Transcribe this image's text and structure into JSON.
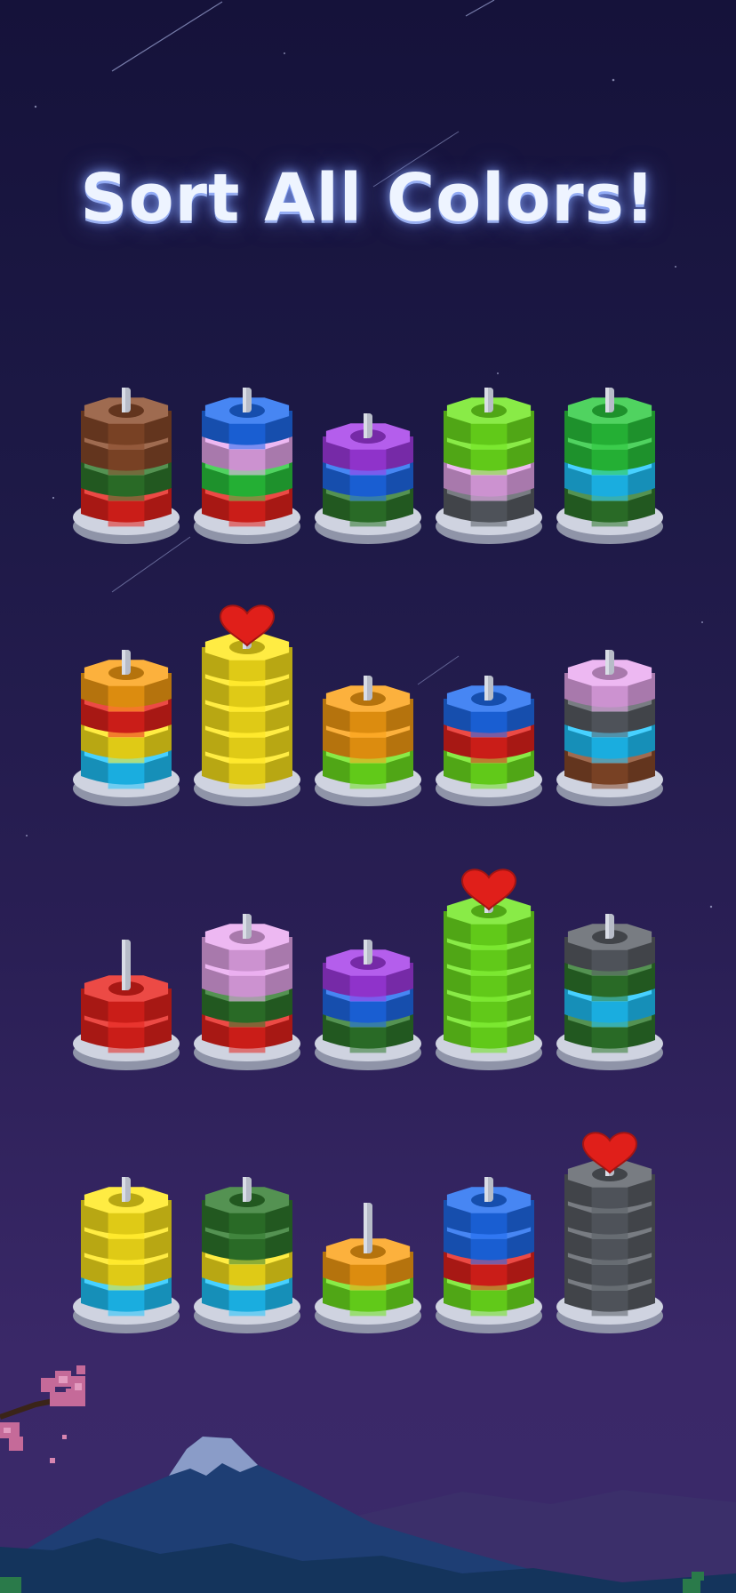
{
  "title": "Sort All Colors!",
  "colors": {
    "red": "#e8221c",
    "brown": "#8a4a2a",
    "dkgreen": "#2f7a2c",
    "green": "#29c93d",
    "lime": "#6fe61e",
    "blue": "#1e6cf0",
    "cyan": "#1fc7ff",
    "pink": "#e9a8ef",
    "purple": "#a43be8",
    "gray": "#5a5f66",
    "yellow": "#ffe81a",
    "orange": "#fba012"
  },
  "tower_rows": [
    {
      "towers": [
        {
          "rings": [
            "red",
            "dkgreen",
            "brown",
            "brown"
          ],
          "heart": false
        },
        {
          "rings": [
            "red",
            "green",
            "pink",
            "blue"
          ],
          "heart": false
        },
        {
          "rings": [
            "dkgreen",
            "blue",
            "purple"
          ],
          "heart": false
        },
        {
          "rings": [
            "gray",
            "pink",
            "lime",
            "lime"
          ],
          "heart": false
        },
        {
          "rings": [
            "dkgreen",
            "cyan",
            "green",
            "green"
          ],
          "heart": false
        }
      ]
    },
    {
      "towers": [
        {
          "rings": [
            "cyan",
            "yellow",
            "red",
            "orange"
          ],
          "heart": false
        },
        {
          "rings": [
            "yellow",
            "yellow",
            "yellow",
            "yellow",
            "yellow"
          ],
          "heart": true
        },
        {
          "rings": [
            "lime",
            "orange",
            "orange"
          ],
          "heart": false
        },
        {
          "rings": [
            "lime",
            "red",
            "blue"
          ],
          "heart": false
        },
        {
          "rings": [
            "brown",
            "cyan",
            "gray",
            "pink"
          ],
          "heart": false
        }
      ]
    },
    {
      "towers": [
        {
          "rings": [
            "red",
            "red"
          ],
          "heart": false
        },
        {
          "rings": [
            "red",
            "dkgreen",
            "pink",
            "pink"
          ],
          "heart": false
        },
        {
          "rings": [
            "dkgreen",
            "blue",
            "purple"
          ],
          "heart": false
        },
        {
          "rings": [
            "lime",
            "lime",
            "lime",
            "lime",
            "lime"
          ],
          "heart": true
        },
        {
          "rings": [
            "dkgreen",
            "cyan",
            "dkgreen",
            "gray"
          ],
          "heart": false
        }
      ]
    },
    {
      "towers": [
        {
          "rings": [
            "cyan",
            "yellow",
            "yellow",
            "yellow"
          ],
          "heart": false
        },
        {
          "rings": [
            "cyan",
            "yellow",
            "dkgreen",
            "dkgreen"
          ],
          "heart": false
        },
        {
          "rings": [
            "lime",
            "orange"
          ],
          "heart": false
        },
        {
          "rings": [
            "lime",
            "red",
            "blue",
            "blue"
          ],
          "heart": false
        },
        {
          "rings": [
            "gray",
            "gray",
            "gray",
            "gray",
            "gray"
          ],
          "heart": true
        }
      ]
    }
  ]
}
